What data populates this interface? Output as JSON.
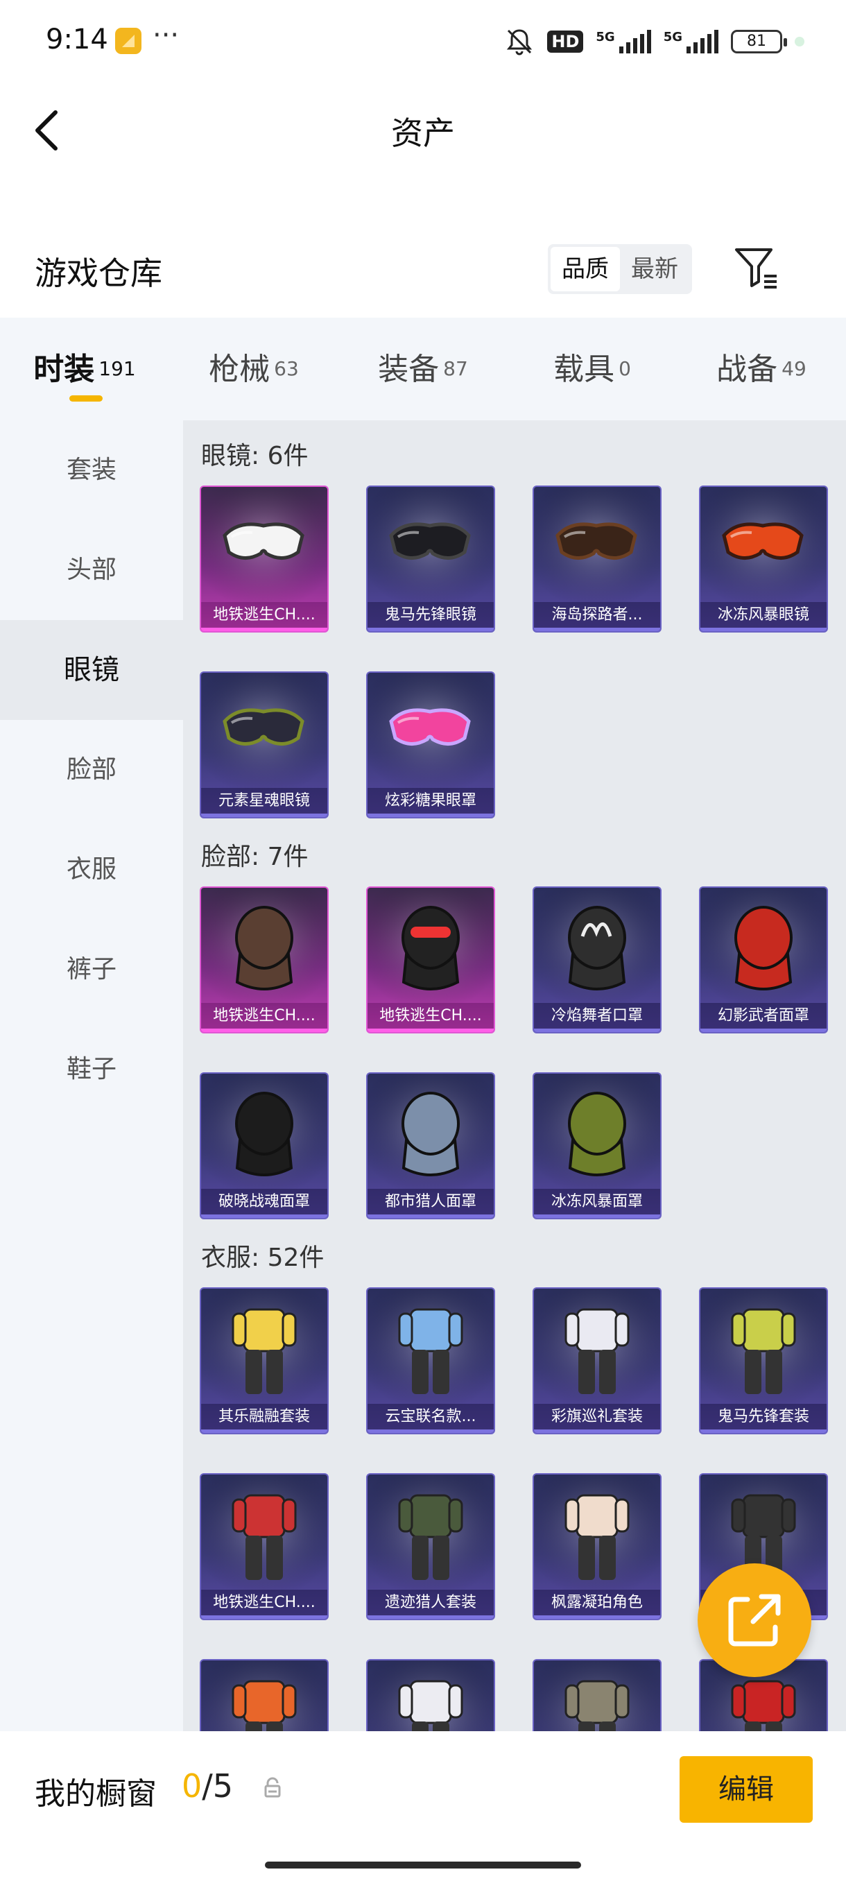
{
  "status_bar": {
    "time": "9:14",
    "hd": "HD",
    "net1": "5G",
    "net2": "5G",
    "battery": "81"
  },
  "header": {
    "title": "资产"
  },
  "warehouse": {
    "title": "游戏仓库",
    "sort_options": [
      "品质",
      "最新"
    ],
    "active_sort": 0
  },
  "tabs": [
    {
      "label": "时装",
      "count": "191"
    },
    {
      "label": "枪械",
      "count": "63"
    },
    {
      "label": "装备",
      "count": "87"
    },
    {
      "label": "载具",
      "count": "0"
    },
    {
      "label": "战备",
      "count": "49"
    }
  ],
  "sidebar": {
    "items": [
      "套装",
      "头部",
      "眼镜",
      "脸部",
      "衣服",
      "裤子",
      "鞋子"
    ],
    "active_index": 2
  },
  "categories": [
    {
      "title": "眼镜: 6件",
      "items": [
        {
          "label": "地铁逃生CH....",
          "rarity": "pink",
          "icon": "goggles-white"
        },
        {
          "label": "鬼马先锋眼镜",
          "rarity": "purple",
          "icon": "sunglasses-black"
        },
        {
          "label": "海岛探路者...",
          "rarity": "purple",
          "icon": "sunglasses-brown"
        },
        {
          "label": "冰冻风暴眼镜",
          "rarity": "purple",
          "icon": "sunglasses-orange"
        },
        {
          "label": "元素星魂眼镜",
          "rarity": "purple",
          "icon": "sunglasses-green"
        },
        {
          "label": "炫彩糖果眼罩",
          "rarity": "purple",
          "icon": "eyemask-pink"
        }
      ]
    },
    {
      "title": "脸部: 7件",
      "items": [
        {
          "label": "地铁逃生CH....",
          "rarity": "pink",
          "icon": "face-mask-brown"
        },
        {
          "label": "地铁逃生CH....",
          "rarity": "pink",
          "icon": "balaclava-red"
        },
        {
          "label": "冷焰舞者口罩",
          "rarity": "purple",
          "icon": "neck-gaiter-flame"
        },
        {
          "label": "幻影武者面罩",
          "rarity": "purple",
          "icon": "gas-mask-red"
        },
        {
          "label": "破晓战魂面罩",
          "rarity": "purple",
          "icon": "armor-mask-black"
        },
        {
          "label": "都市猎人面罩",
          "rarity": "purple",
          "icon": "scarf-mask-blue"
        },
        {
          "label": "冰冻风暴面罩",
          "rarity": "purple",
          "icon": "scarf-mask-green"
        }
      ]
    },
    {
      "title": "衣服: 52件",
      "items": [
        {
          "label": "其乐融融套装",
          "rarity": "purple",
          "icon": "outfit-yellow"
        },
        {
          "label": "云宝联名款...",
          "rarity": "purple",
          "icon": "outfit-blue"
        },
        {
          "label": "彩旗巡礼套装",
          "rarity": "purple",
          "icon": "outfit-white"
        },
        {
          "label": "鬼马先锋套装",
          "rarity": "purple",
          "icon": "outfit-lime"
        },
        {
          "label": "地铁逃生CH....",
          "rarity": "purple",
          "icon": "outfit-red-black"
        },
        {
          "label": "遗迹猎人套装",
          "rarity": "purple",
          "icon": "outfit-camo"
        },
        {
          "label": "枫露凝珀角色",
          "rarity": "purple",
          "icon": "character-dress"
        },
        {
          "label": "...套装",
          "rarity": "purple",
          "icon": "outfit-dark"
        },
        {
          "label": "",
          "rarity": "purple",
          "icon": "outfit-orange"
        },
        {
          "label": "",
          "rarity": "purple",
          "icon": "outfit-white-suit"
        },
        {
          "label": "",
          "rarity": "purple",
          "icon": "outfit-coat"
        },
        {
          "label": "",
          "rarity": "purple",
          "icon": "outfit-red-jacket"
        }
      ]
    }
  ],
  "bottom_bar": {
    "title": "我的橱窗",
    "count_current": "0",
    "count_total": "/5",
    "edit_label": "编辑"
  },
  "colors": {
    "accent": "#f5b500",
    "rarity_pink": "#e057d4",
    "rarity_purple": "#6a62c4"
  }
}
